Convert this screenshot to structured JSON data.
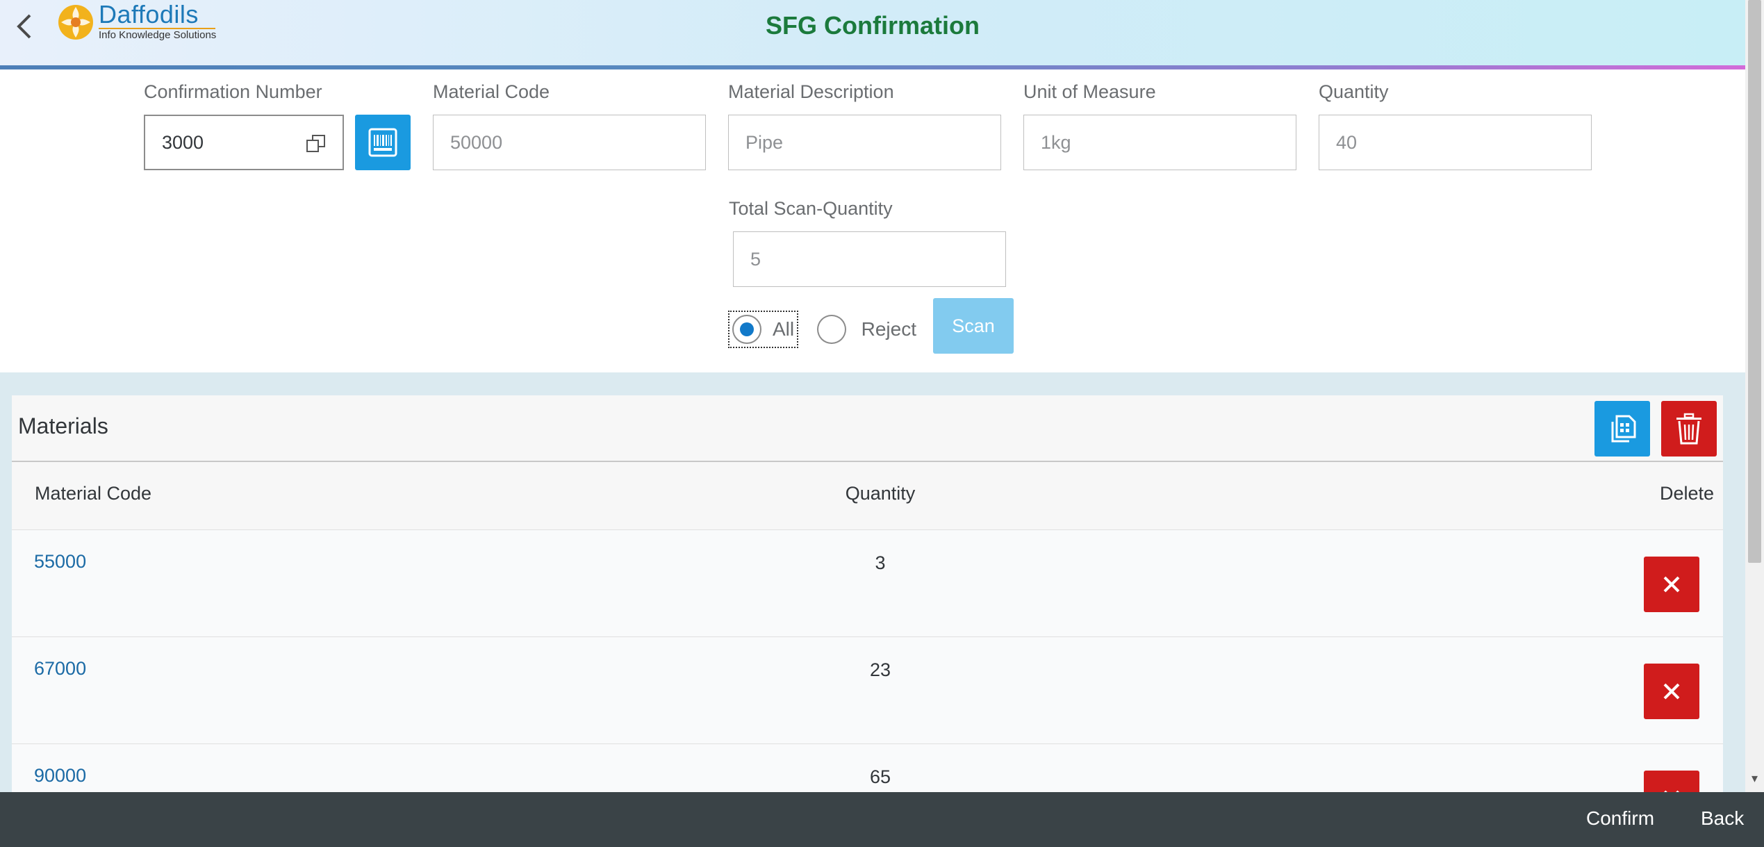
{
  "header": {
    "title": "SFG Confirmation",
    "logo_name": "Daffodils",
    "logo_tagline": "Info Knowledge Solutions"
  },
  "form": {
    "confirmation_number": {
      "label": "Confirmation Number",
      "value": "3000"
    },
    "material_code": {
      "label": "Material Code",
      "value": "50000"
    },
    "material_description": {
      "label": "Material Description",
      "value": "Pipe"
    },
    "unit_of_measure": {
      "label": "Unit of Measure",
      "value": "1kg"
    },
    "quantity": {
      "label": "Quantity",
      "value": "40"
    },
    "total_scan_quantity": {
      "label": "Total Scan-Quantity",
      "value": "5"
    },
    "radio_all": {
      "label": "All",
      "selected": true
    },
    "radio_reject": {
      "label": "Reject",
      "selected": false
    },
    "scan_label": "Scan"
  },
  "materials": {
    "title": "Materials",
    "columns": [
      "Material Code",
      "Quantity",
      "Delete"
    ],
    "rows": [
      {
        "code": "55000",
        "quantity": "3"
      },
      {
        "code": "67000",
        "quantity": "23"
      },
      {
        "code": "90000",
        "quantity": "65"
      }
    ]
  },
  "footer": {
    "confirm_label": "Confirm",
    "back_label": "Back"
  },
  "colors": {
    "title": "#1b7a3c",
    "primary_button": "#1a9ae0",
    "delete_button": "#d01c1c",
    "link": "#1b6aa5",
    "footer": "#3a4347"
  }
}
